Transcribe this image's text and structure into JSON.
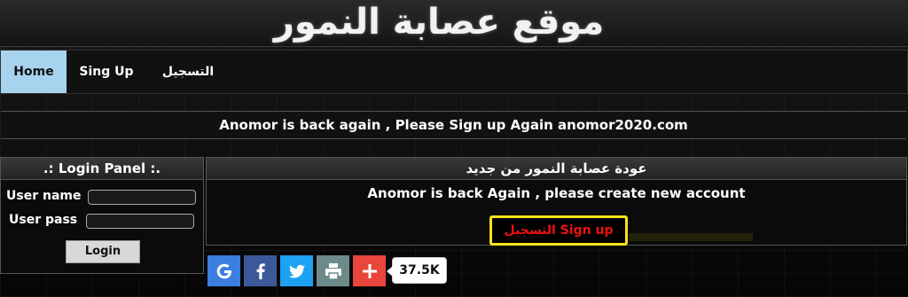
{
  "site": {
    "title": "موقع عصابة النمور"
  },
  "nav": {
    "items": [
      "Home",
      "Sing Up",
      "التسجيل"
    ]
  },
  "notice": {
    "text": "Anomor is back again , Please Sign up Again anomor2020.com"
  },
  "login_panel": {
    "title": ".: Login Panel :.",
    "username_label": "User name",
    "password_label": "User pass",
    "username_value": "",
    "password_value": "",
    "login_button": "Login"
  },
  "main": {
    "heading": "عودة عصابة النمور من جديد",
    "message": "Anomor is back Again , please create new account",
    "signup_label": "التسجيل Sign up"
  },
  "share": {
    "icons": [
      "google-icon",
      "facebook-icon",
      "twitter-icon",
      "print-icon",
      "plus-icon"
    ],
    "colors": {
      "google": "#3b7fe0",
      "facebook": "#3b5998",
      "twitter": "#1da1f2",
      "print": "#6d8a8a",
      "plus": "#e8463c"
    },
    "count": "37.5K"
  },
  "colors": {
    "active_tab": "#a8d3ef",
    "signup_border": "#f5e21a",
    "signup_text": "#ee1111"
  }
}
